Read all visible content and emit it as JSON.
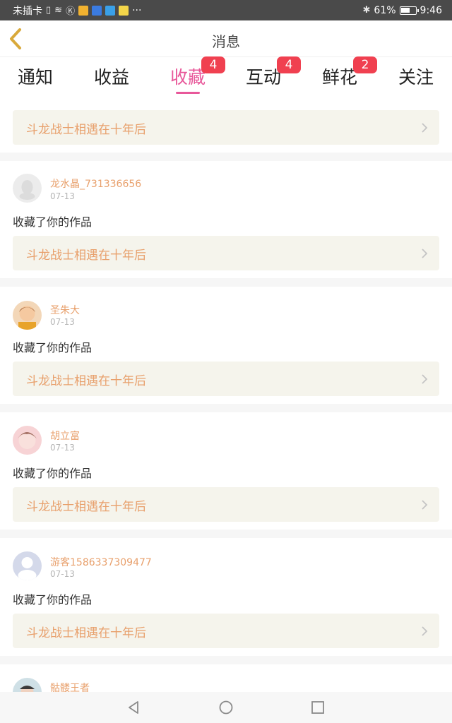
{
  "statusbar": {
    "carrier": "未插卡",
    "battery": "61%",
    "time": "9:46",
    "more": "···"
  },
  "navbar": {
    "title": "消息"
  },
  "tabs": [
    {
      "label": "通知",
      "badge": ""
    },
    {
      "label": "收益",
      "badge": ""
    },
    {
      "label": "收藏",
      "badge": "4"
    },
    {
      "label": "互动",
      "badge": "4"
    },
    {
      "label": "鲜花",
      "badge": "2"
    },
    {
      "label": "关注",
      "badge": ""
    }
  ],
  "top_work": {
    "title": "斗龙战士相遇在十年后"
  },
  "items": [
    {
      "user": "龙水晶_731336656",
      "date": "07-13",
      "action": "收藏了你的作品",
      "work": "斗龙战士相遇在十年后"
    },
    {
      "user": "圣朱大",
      "date": "07-13",
      "action": "收藏了你的作品",
      "work": "斗龙战士相遇在十年后"
    },
    {
      "user": "胡立富",
      "date": "07-13",
      "action": "收藏了你的作品",
      "work": "斗龙战士相遇在十年后"
    },
    {
      "user": "游客1586337309477",
      "date": "07-13",
      "action": "收藏了你的作品",
      "work": "斗龙战士相遇在十年后"
    },
    {
      "user": "骷髅王者",
      "date": "",
      "action": "",
      "work": ""
    }
  ],
  "colors": {
    "accent": "#e8589a",
    "badge": "#f04050",
    "orange_text": "#e8a06c",
    "work_bg": "#f5f4ec"
  }
}
